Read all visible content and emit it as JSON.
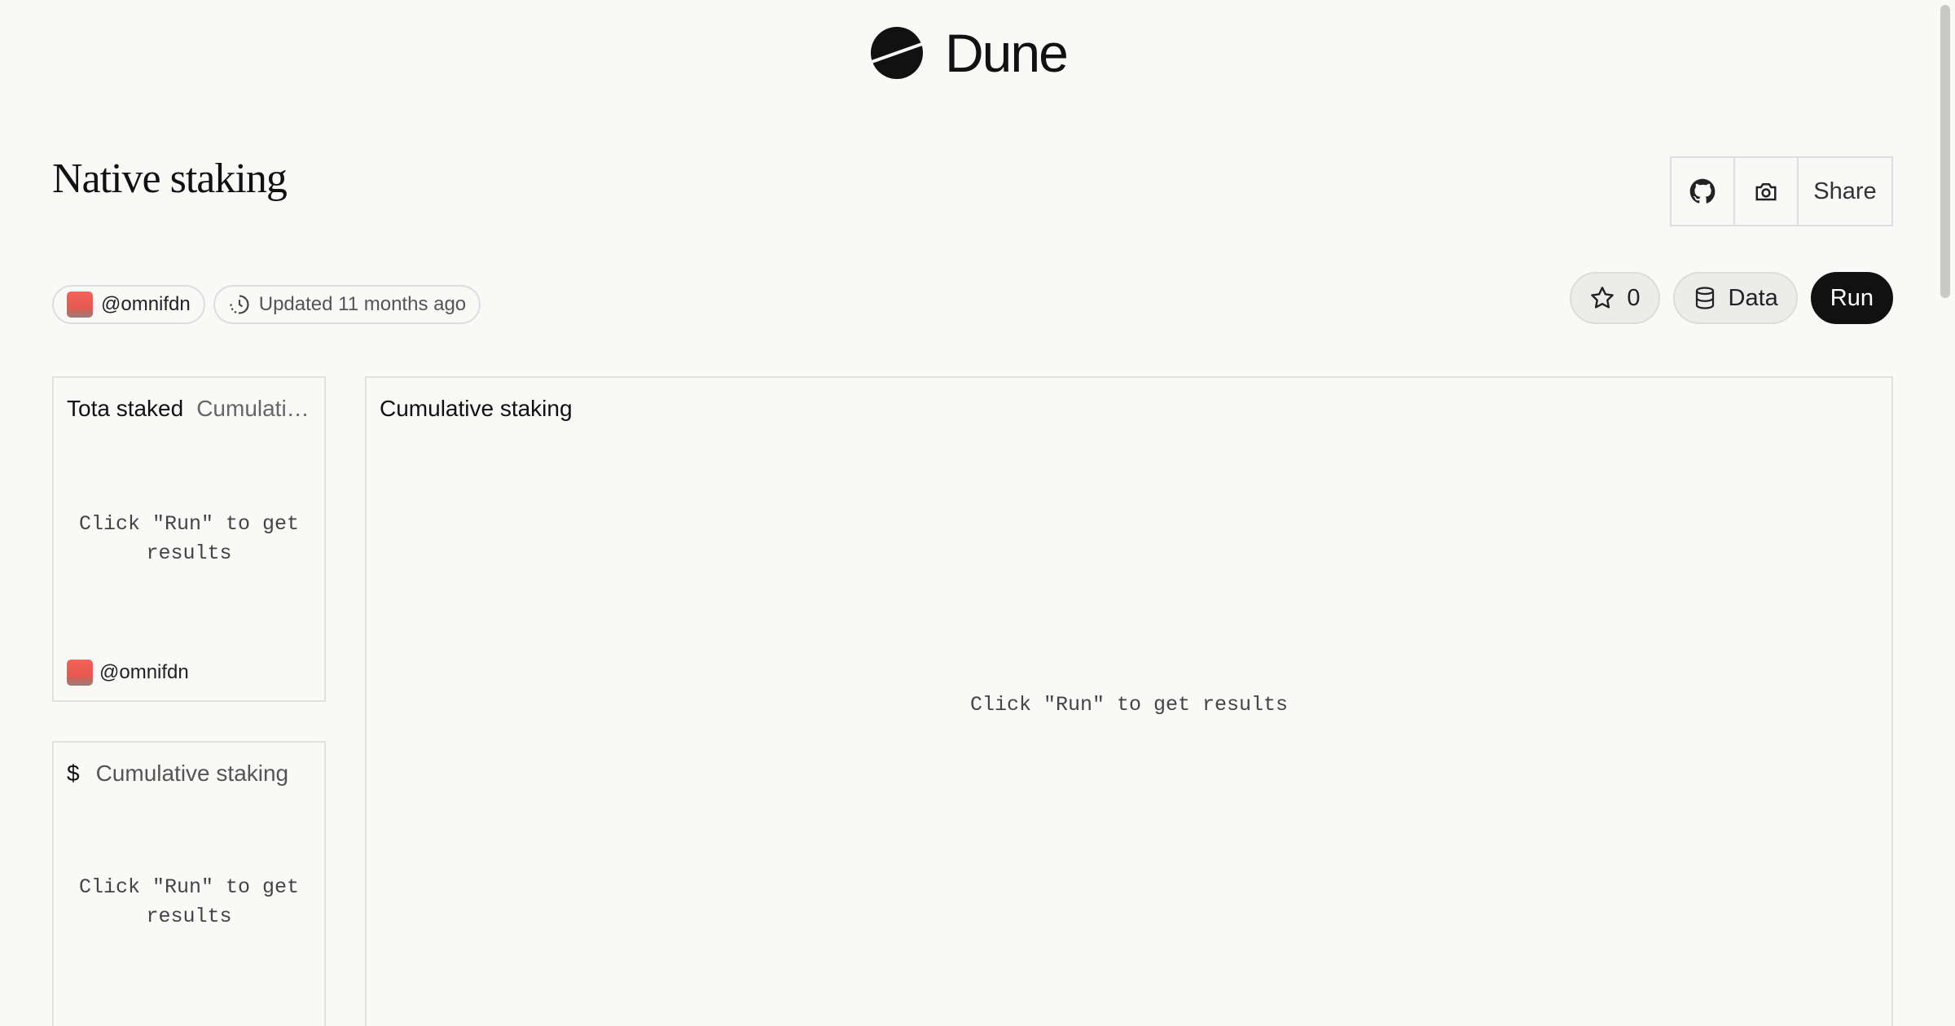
{
  "brand": {
    "name": "Dune"
  },
  "page": {
    "title": "Native staking"
  },
  "actions": {
    "share_label": "Share",
    "github_icon": "github-icon",
    "camera_icon": "camera-icon"
  },
  "meta": {
    "author": "@omnifdn",
    "updated": "Updated 11 months ago"
  },
  "toolbar": {
    "star_count": "0",
    "data_label": "Data",
    "run_label": "Run"
  },
  "cards": [
    {
      "title": "Tota staked",
      "subtitle": "Cumulati…",
      "placeholder": "Click \"Run\" to get results",
      "author": "@omnifdn"
    },
    {
      "prefix": "$",
      "title": "Cumulative staking",
      "placeholder": "Click \"Run\" to get results"
    },
    {
      "title": "Cumulative staking",
      "placeholder": "Click \"Run\" to get results"
    }
  ],
  "colors": {
    "background": "#f9f9f7",
    "run_button": "#111111",
    "avatar": "#f0645a"
  }
}
